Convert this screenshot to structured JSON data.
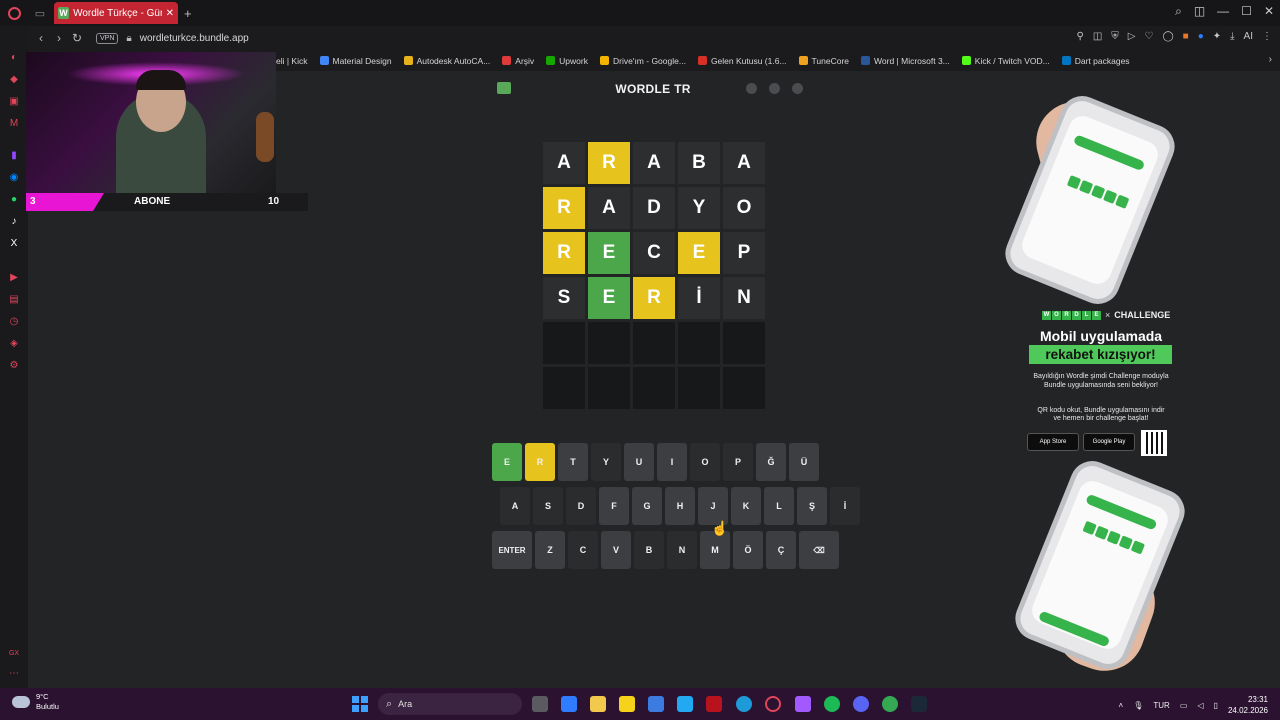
{
  "browser": {
    "tab_title": "Wordle Türkçe - Günlük Kelime",
    "tab_favicon": "W",
    "url": "wordleturkce.bundle.app",
    "vpn_label": "VPN",
    "bookmarks": [
      {
        "label": "eli | Kick",
        "color": "#53fc18"
      },
      {
        "label": "Material Design",
        "color": "#4285f4"
      },
      {
        "label": "Autodesk AutoCA...",
        "color": "#e8b21a"
      },
      {
        "label": "Arşiv",
        "color": "#e03b3b"
      },
      {
        "label": "Upwork",
        "color": "#14a800"
      },
      {
        "label": "Drive'ım - Google...",
        "color": "#f4b400"
      },
      {
        "label": "Gelen Kutusu (1.6...",
        "color": "#d93025"
      },
      {
        "label": "TuneCore",
        "color": "#f0a21f"
      },
      {
        "label": "Word | Microsoft 3...",
        "color": "#2b579a"
      },
      {
        "label": "Kick / Twitch VOD...",
        "color": "#53fc18"
      },
      {
        "label": "Dart packages",
        "color": "#0175c2"
      }
    ]
  },
  "stream_overlay": {
    "count_left": "3",
    "label": "ABONE",
    "count_right": "10"
  },
  "wordle": {
    "title": "WORDLE TR",
    "grid": [
      [
        {
          "l": "A",
          "s": "absent"
        },
        {
          "l": "R",
          "s": "present"
        },
        {
          "l": "A",
          "s": "absent"
        },
        {
          "l": "B",
          "s": "absent"
        },
        {
          "l": "A",
          "s": "absent"
        }
      ],
      [
        {
          "l": "R",
          "s": "present"
        },
        {
          "l": "A",
          "s": "absent"
        },
        {
          "l": "D",
          "s": "absent"
        },
        {
          "l": "Y",
          "s": "absent"
        },
        {
          "l": "O",
          "s": "absent"
        }
      ],
      [
        {
          "l": "R",
          "s": "present"
        },
        {
          "l": "E",
          "s": "correct"
        },
        {
          "l": "C",
          "s": "absent"
        },
        {
          "l": "E",
          "s": "present"
        },
        {
          "l": "P",
          "s": "absent"
        }
      ],
      [
        {
          "l": "S",
          "s": "absent"
        },
        {
          "l": "E",
          "s": "correct"
        },
        {
          "l": "R",
          "s": "present"
        },
        {
          "l": "İ",
          "s": "absent"
        },
        {
          "l": "N",
          "s": "absent"
        }
      ],
      [
        {
          "l": "",
          "s": "empty"
        },
        {
          "l": "",
          "s": "empty"
        },
        {
          "l": "",
          "s": "empty"
        },
        {
          "l": "",
          "s": "empty"
        },
        {
          "l": "",
          "s": "empty"
        }
      ],
      [
        {
          "l": "",
          "s": "empty"
        },
        {
          "l": "",
          "s": "empty"
        },
        {
          "l": "",
          "s": "empty"
        },
        {
          "l": "",
          "s": "empty"
        },
        {
          "l": "",
          "s": "empty"
        }
      ]
    ],
    "keyboard": [
      [
        {
          "k": "E",
          "s": "correct"
        },
        {
          "k": "R",
          "s": "present"
        },
        {
          "k": "T",
          "s": "unused"
        },
        {
          "k": "Y",
          "s": "used"
        },
        {
          "k": "U",
          "s": "unused"
        },
        {
          "k": "I",
          "s": "unused"
        },
        {
          "k": "O",
          "s": "used"
        },
        {
          "k": "P",
          "s": "used"
        },
        {
          "k": "Ğ",
          "s": "unused"
        },
        {
          "k": "Ü",
          "s": "unused"
        }
      ],
      [
        {
          "k": "A",
          "s": "used"
        },
        {
          "k": "S",
          "s": "used"
        },
        {
          "k": "D",
          "s": "used"
        },
        {
          "k": "F",
          "s": "unused"
        },
        {
          "k": "G",
          "s": "unused"
        },
        {
          "k": "H",
          "s": "unused"
        },
        {
          "k": "J",
          "s": "unused"
        },
        {
          "k": "K",
          "s": "unused"
        },
        {
          "k": "L",
          "s": "unused"
        },
        {
          "k": "Ş",
          "s": "unused"
        },
        {
          "k": "İ",
          "s": "used"
        }
      ],
      [
        {
          "k": "ENTER",
          "s": "unused",
          "wide": true
        },
        {
          "k": "Z",
          "s": "unused"
        },
        {
          "k": "C",
          "s": "used"
        },
        {
          "k": "V",
          "s": "unused"
        },
        {
          "k": "B",
          "s": "used"
        },
        {
          "k": "N",
          "s": "used"
        },
        {
          "k": "M",
          "s": "unused"
        },
        {
          "k": "Ö",
          "s": "unused"
        },
        {
          "k": "Ç",
          "s": "unused"
        },
        {
          "k": "⌫",
          "s": "unused",
          "wide": true
        }
      ]
    ]
  },
  "ad": {
    "brand_letters": [
      "W",
      "O",
      "R",
      "D",
      "L",
      "E"
    ],
    "brand_x": "×",
    "brand_challenge": "CHALLENGE",
    "headline": "Mobil uygulamada",
    "highlight": "rekabet kızışıyor!",
    "line1": "Bayıldığın Wordle şimdi Challenge moduyla",
    "line2": "Bundle uygulamasında seni bekliyor!",
    "line3": "QR kodu okut, Bundle uygulamasını indir",
    "line4": "ve hemen bir challenge başlat!",
    "app_store": "App Store",
    "google_play": "Google Play"
  },
  "taskbar": {
    "weather_temp": "9°C",
    "weather_desc": "Bulutlu",
    "search_placeholder": "Ara",
    "lang": "TUR",
    "time": "23:31",
    "date": "24.02.2026"
  }
}
